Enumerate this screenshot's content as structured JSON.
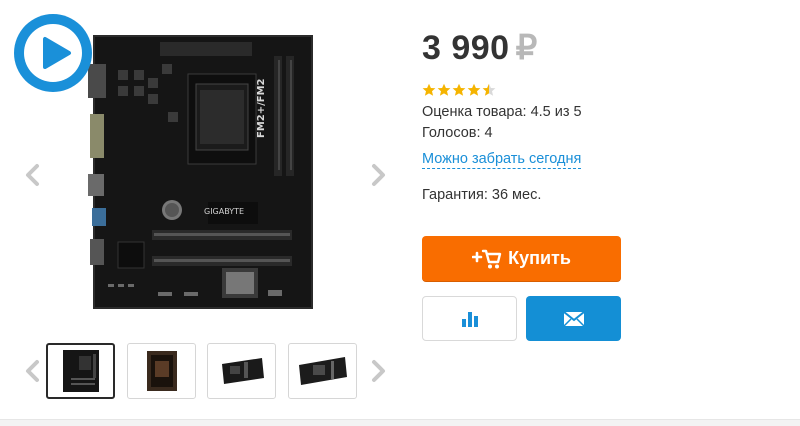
{
  "gallery": {
    "video_button_icon": "play-icon",
    "main_image": "motherboard-photo",
    "main_image_label": "GIGABYTE",
    "main_image_chip_label": "FM2+/FM2",
    "prev_icon": "chevron-left-icon",
    "next_icon": "chevron-right-icon",
    "thumbnails": [
      {
        "name": "thumbnail-1",
        "active": true
      },
      {
        "name": "thumbnail-2",
        "active": false
      },
      {
        "name": "thumbnail-3",
        "active": false
      },
      {
        "name": "thumbnail-4",
        "active": false
      }
    ]
  },
  "product": {
    "price": "3 990",
    "currency": "₽",
    "rating": 4.5,
    "rating_max": 5,
    "rating_text": "Оценка товара: 4.5 из 5",
    "votes_text": "Голосов: 4",
    "pickup_link": "Можно забрать сегодня",
    "warranty_text": "Гарантия: 36 мес."
  },
  "actions": {
    "buy_label": "Купить",
    "buy_icon": "add-to-cart-icon",
    "compare_icon": "bar-chart-icon",
    "mail_icon": "envelope-icon"
  },
  "colors": {
    "accent_blue": "#1a90d9",
    "buy_orange": "#f96d00",
    "star_gold": "#f5b400",
    "price_text": "#333333",
    "currency_gray": "#b8b8b8"
  }
}
